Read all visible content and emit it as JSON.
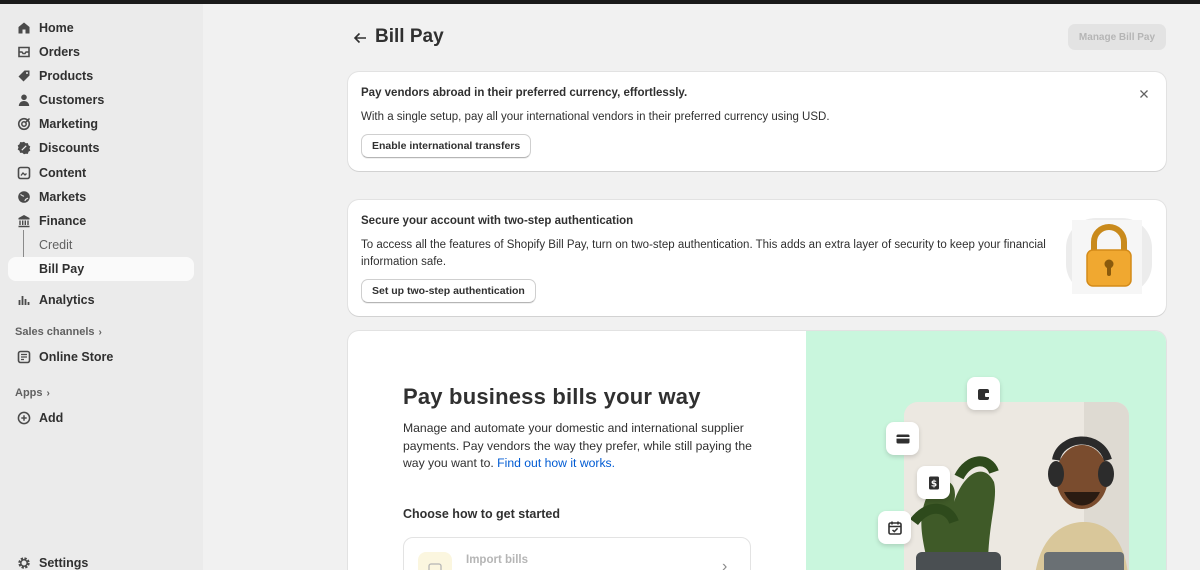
{
  "nav": {
    "items": [
      {
        "label": "Home",
        "icon": "home-icon"
      },
      {
        "label": "Orders",
        "icon": "orders-icon"
      },
      {
        "label": "Products",
        "icon": "tag-icon"
      },
      {
        "label": "Customers",
        "icon": "person-icon"
      },
      {
        "label": "Marketing",
        "icon": "target-icon"
      },
      {
        "label": "Discounts",
        "icon": "discount-icon"
      },
      {
        "label": "Content",
        "icon": "content-icon"
      },
      {
        "label": "Markets",
        "icon": "globe-icon"
      },
      {
        "label": "Finance",
        "icon": "bank-icon"
      }
    ],
    "finance_sub": [
      {
        "label": "Credit"
      },
      {
        "label": "Bill Pay",
        "active": true
      }
    ],
    "analytics": "Analytics",
    "sales_channels_label": "Sales channels",
    "online_store": "Online Store",
    "apps_label": "Apps",
    "add": "Add",
    "settings": "Settings"
  },
  "header": {
    "title": "Bill Pay",
    "manage_button": "Manage Bill Pay"
  },
  "banner_intl": {
    "title": "Pay vendors abroad in their preferred currency, effortlessly.",
    "text": "With a single setup, pay all your international vendors in their preferred currency using USD.",
    "button": "Enable international transfers"
  },
  "banner_2fa": {
    "title": "Secure your account with two-step authentication",
    "text": "To access all the features of Shopify Bill Pay, turn on two-step authentication. This adds an extra layer of security to keep your financial information safe.",
    "button": "Set up two-step authentication"
  },
  "hero": {
    "title": "Pay business bills your way",
    "text": "Manage and automate your domestic and international supplier payments. Pay vendors the way they prefer, while still paying the way you want to.",
    "link": "Find out how it works.",
    "choose_label": "Choose how to get started",
    "import_label": "Import bills"
  },
  "colors": {
    "accent_link": "#005bd3",
    "green_panel": "#c9f6dd",
    "sidebar_bg": "#ebebeb"
  }
}
